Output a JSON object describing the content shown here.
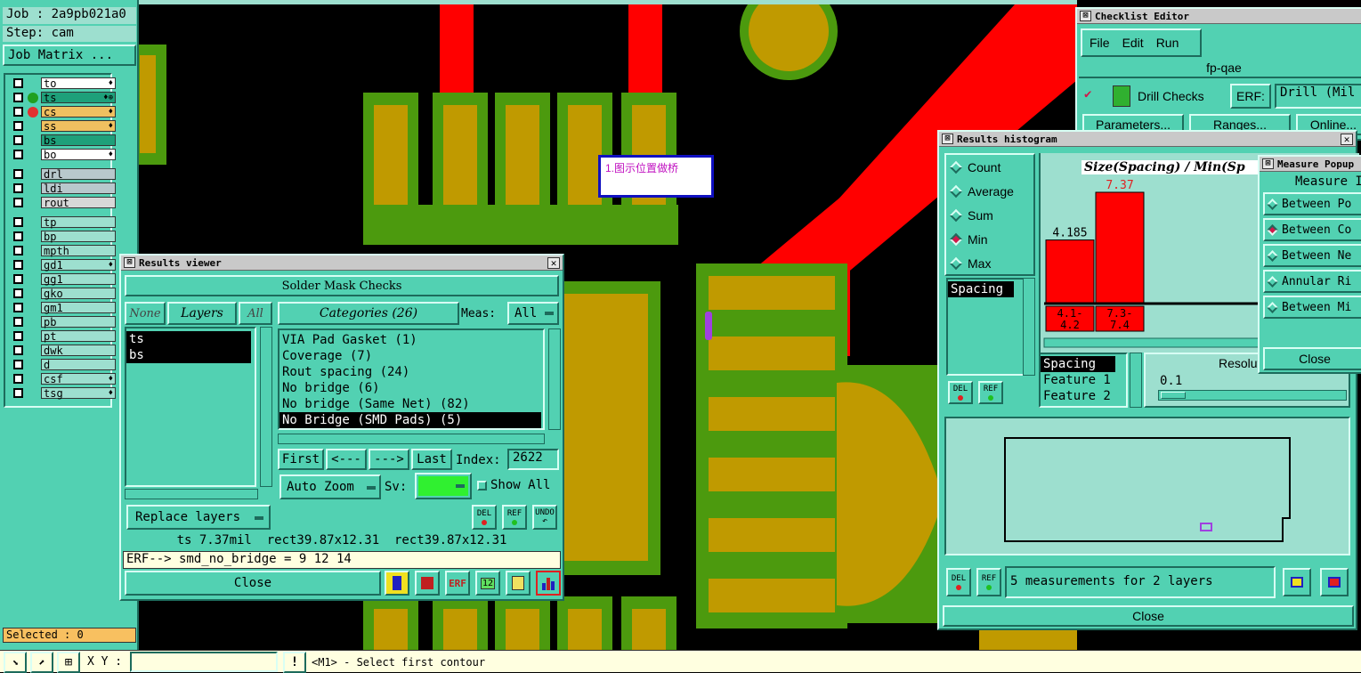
{
  "job_panel": {
    "job": "Job : 2a9pb021a0",
    "step": "Step: cam",
    "job_matrix": "Job Matrix ..."
  },
  "layers": [
    {
      "name": "to",
      "bg": "#ffffff",
      "tag": "♦",
      "dot": ""
    },
    {
      "name": "ts",
      "bg": "#1ea07a",
      "tag": "♦⊕",
      "dot": "#20a020"
    },
    {
      "name": "cs",
      "bg": "#f0c060",
      "tag": "♦",
      "dot": "#e03030"
    },
    {
      "name": "ss",
      "bg": "#f0c060",
      "tag": "♦",
      "dot": ""
    },
    {
      "name": "bs",
      "bg": "#1ea07a",
      "tag": "",
      "dot": ""
    },
    {
      "name": "bo",
      "bg": "#ffffff",
      "tag": "♦",
      "dot": ""
    }
  ],
  "layers_drill": [
    {
      "name": "drl",
      "bg": "#b8c8cc"
    },
    {
      "name": "ldi",
      "bg": "#b8c8cc"
    },
    {
      "name": "rout",
      "bg": "#d8d8d8"
    }
  ],
  "layers_misc": [
    {
      "name": "tp",
      "tag": ""
    },
    {
      "name": "bp",
      "tag": ""
    },
    {
      "name": "mpth",
      "tag": ""
    },
    {
      "name": "gd1",
      "tag": "♦"
    },
    {
      "name": "gg1",
      "tag": ""
    },
    {
      "name": "gko",
      "tag": ""
    },
    {
      "name": "gm1",
      "tag": ""
    },
    {
      "name": "pb",
      "tag": ""
    },
    {
      "name": "pt",
      "tag": ""
    },
    {
      "name": "dwk",
      "tag": ""
    },
    {
      "name": "d",
      "tag": ""
    },
    {
      "name": "csf",
      "tag": "♦"
    },
    {
      "name": "tsg",
      "tag": "♦"
    }
  ],
  "selected": "Selected : 0",
  "annotation": "1.图示位置做桥",
  "results_viewer": {
    "title": "Results viewer",
    "header": "Solder Mask Checks",
    "none": "None",
    "layers": "Layers",
    "all": "All",
    "categories": "Categories (26)",
    "meas_label": "Meas:",
    "meas_value": "All",
    "layer_items": [
      "ts",
      "bs"
    ],
    "category_items": [
      "VIA Pad Gasket (1)",
      "Coverage (7)",
      "Rout spacing (24)",
      "No bridge (6)",
      "No bridge (Same Net) (82)",
      "No Bridge (SMD Pads) (5)"
    ],
    "first": "First",
    "prev": "<---",
    "next": "--->",
    "last": "Last",
    "index_label": "Index:",
    "index_value": "2622",
    "auto_zoom": "Auto Zoom",
    "sv": "Sv:",
    "show_all": "Show All",
    "replace_layers": "Replace layers",
    "del": "DEL",
    "ref": "REF",
    "undo": "UNDO",
    "status": "ts 7.37mil  rect39.87x12.31  rect39.87x12.31",
    "erf": "ERF--> smd_no_bridge = 9 12 14",
    "close": "Close"
  },
  "checklist_editor": {
    "title": "Checklist Editor",
    "menu": [
      "File",
      "Edit",
      "Run"
    ],
    "name": "fp-qae",
    "drill_checks": "Drill Checks",
    "erf": "ERF:",
    "erf_value": "Drill (Mil",
    "buttons": [
      "Parameters...",
      "Ranges...",
      "Online..."
    ]
  },
  "histogram": {
    "title": "Results histogram",
    "options": [
      "Count",
      "Average",
      "Sum",
      "Min",
      "Max"
    ],
    "selected_option": "Min",
    "list_item": "Spacing",
    "chart_title": "Size(Spacing) / Min(Sp",
    "bars": [
      {
        "label": "4.185",
        "range": "4.1-\n 4.2"
      },
      {
        "label": "7.37",
        "range": "7.3-\n 7.4"
      }
    ],
    "list2": [
      "Spacing",
      "Feature 1",
      "Feature 2"
    ],
    "resolution_label": "Resolut",
    "resolution_value": "0.1",
    "summary": "5 measurements for 2 layers",
    "close": "Close",
    "del": "DEL",
    "ref": "REF"
  },
  "chart_data": {
    "type": "bar",
    "categories": [
      "4.1-4.2",
      "7.3-7.4"
    ],
    "values": [
      4.185,
      7.37
    ],
    "title": "Size(Spacing) / Min(Sp"
  },
  "measure_popup": {
    "title": "Measure Popup",
    "header": "Measure I",
    "items": [
      "Between Po",
      "Between Co",
      "Between Ne",
      "Annular Ri",
      "Between Mi"
    ],
    "selected": "Between Co",
    "close": "Close"
  },
  "bottom_bar": {
    "xy_label": "X Y :",
    "xy_value": "",
    "hint": "<M1> - Select first contour"
  }
}
